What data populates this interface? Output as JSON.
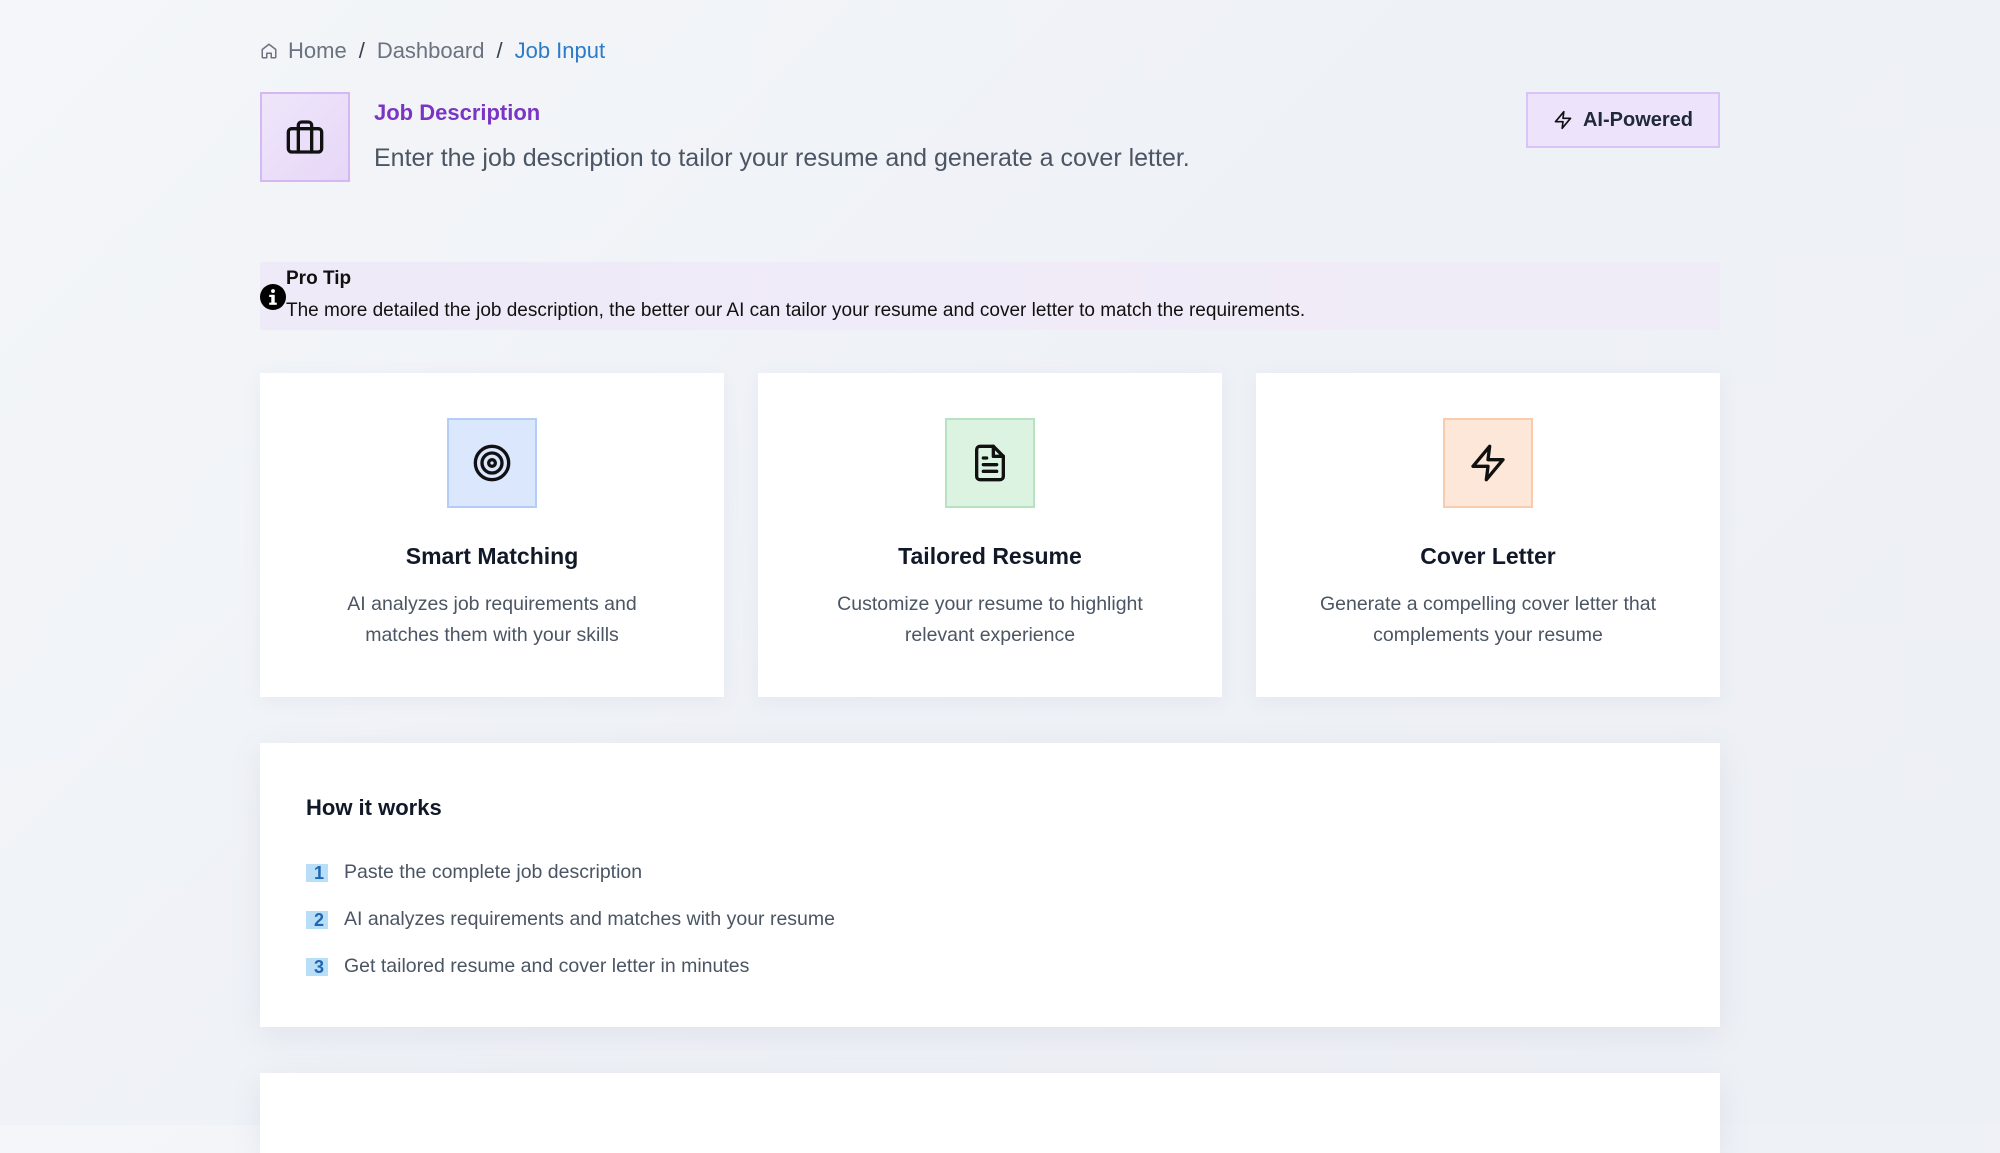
{
  "breadcrumb": {
    "home": "Home",
    "dashboard": "Dashboard",
    "current": "Job Input",
    "separator": "/"
  },
  "header": {
    "icon": "briefcase-icon",
    "title": "Job Description",
    "subtitle": "Enter the job description to tailor your resume and generate a cover letter.",
    "badge": "AI-Powered",
    "badge_icon": "lightning-icon"
  },
  "protip": {
    "icon": "info-icon",
    "title": "Pro Tip",
    "text": "The more detailed the job description, the better our AI can tailor your resume and cover letter to match the requirements."
  },
  "features": [
    {
      "icon": "target-icon",
      "title": "Smart Matching",
      "desc_line1": "AI analyzes job requirements and",
      "desc_line2": "matches them with your skills",
      "color": "#dbe7fd"
    },
    {
      "icon": "document-icon",
      "title": "Tailored Resume",
      "desc_line1": "Customize your resume to highlight",
      "desc_line2": "relevant experience",
      "color": "#dcf3e2"
    },
    {
      "icon": "lightning-icon",
      "title": "Cover Letter",
      "desc_line1": "Generate a compelling cover letter that",
      "desc_line2": "complements your resume",
      "color": "#fde7d8"
    }
  ],
  "how_it_works": {
    "title": "How it works",
    "steps": [
      {
        "num": "1",
        "text": "Paste the complete job description"
      },
      {
        "num": "2",
        "text": "AI analyzes requirements and matches with your resume"
      },
      {
        "num": "3",
        "text": "Get tailored resume and cover letter in minutes"
      }
    ]
  },
  "colors": {
    "accent_purple": "#7b35c4",
    "link_blue": "#2b7bc7",
    "step_badge": "#b9def8"
  }
}
